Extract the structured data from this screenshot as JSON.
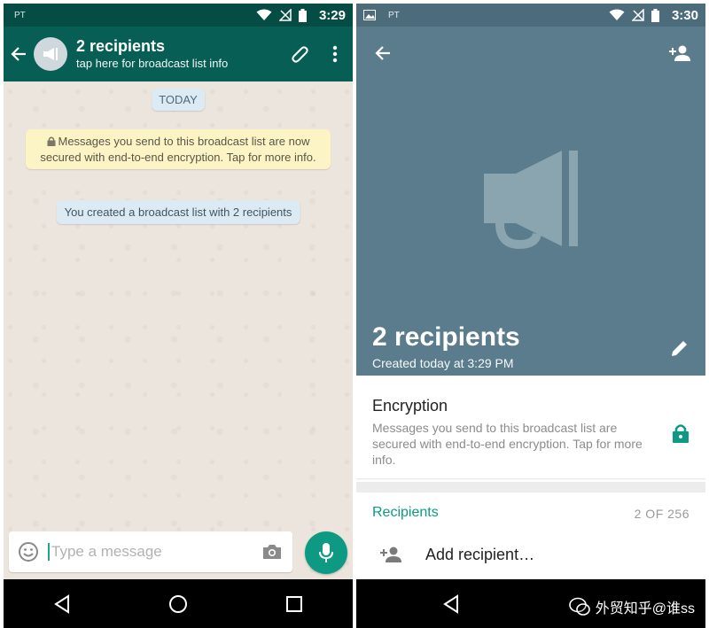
{
  "left": {
    "status": {
      "carrier": "PT",
      "time": "3:29"
    },
    "header": {
      "title": "2 recipients",
      "subtitle": "tap here for broadcast list info"
    },
    "chat": {
      "date_label": "TODAY",
      "encryption_notice": "Messages you send to this broadcast list are now secured with end-to-end encryption. Tap for more info.",
      "system_message": "You created a broadcast list with 2 recipients"
    },
    "composer": {
      "placeholder": "Type a message"
    }
  },
  "right": {
    "status": {
      "carrier": "PT",
      "time": "3:30"
    },
    "hero": {
      "title": "2 recipients",
      "subtitle": "Created today at 3:29 PM"
    },
    "encryption": {
      "title": "Encryption",
      "text": "Messages you send to this broadcast list are secured with end-to-end encryption. Tap for more info."
    },
    "recipients": {
      "title": "Recipients",
      "count": "2 OF 256",
      "add_label": "Add recipient…"
    }
  },
  "watermark": {
    "text": "外贸知乎@谁ss"
  },
  "colors": {
    "header_green": "#075e54",
    "accent_teal": "#0e9a82",
    "hero_bluegray": "#5a7c8c",
    "chat_bg": "#ece5dd"
  },
  "icons": [
    "back-arrow-icon",
    "broadcast-icon",
    "attach-icon",
    "more-vert-icon",
    "lock-icon",
    "emoji-icon",
    "camera-icon",
    "mic-icon",
    "wifi-icon",
    "signal-icon",
    "battery-icon",
    "add-person-icon",
    "edit-icon",
    "nav-back-icon",
    "nav-home-icon",
    "nav-recents-icon"
  ]
}
